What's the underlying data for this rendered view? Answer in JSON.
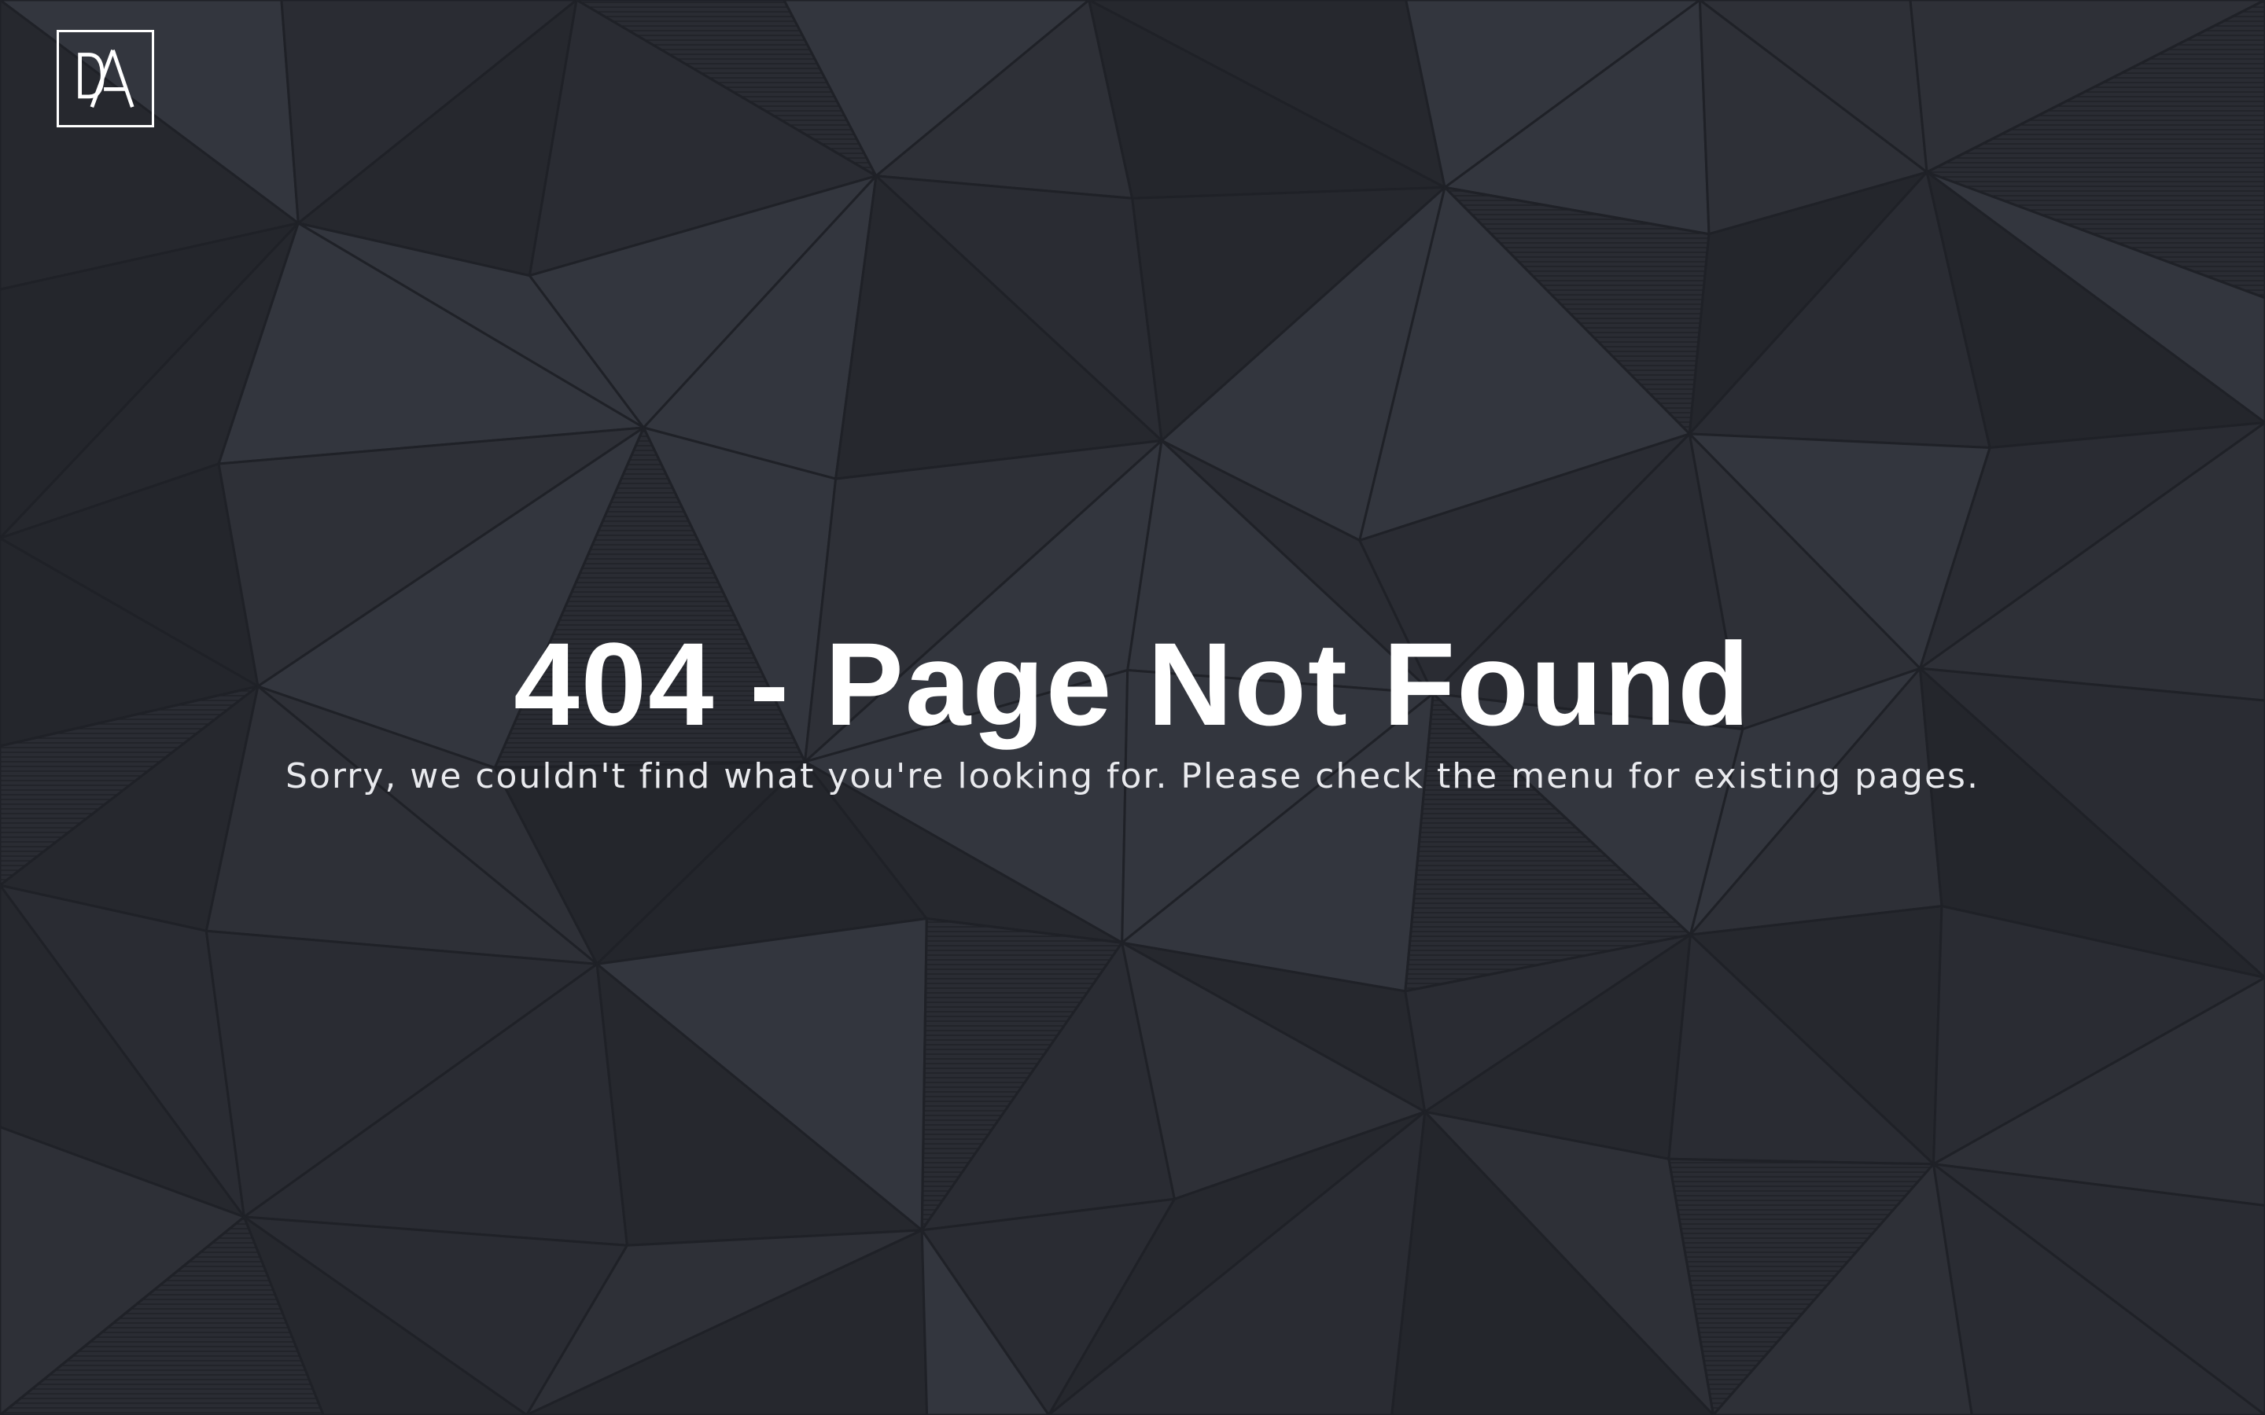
{
  "logo": {
    "text": "DA",
    "icon": "da-monogram-icon"
  },
  "error": {
    "title": "404 - Page Not Found",
    "message": "Sorry, we couldn't find what you're looking for. Please check the menu for existing pages."
  },
  "colors": {
    "background": "#2a2c33",
    "facet_light": "#33363e",
    "facet_dark": "#24262c",
    "text": "#ffffff"
  }
}
